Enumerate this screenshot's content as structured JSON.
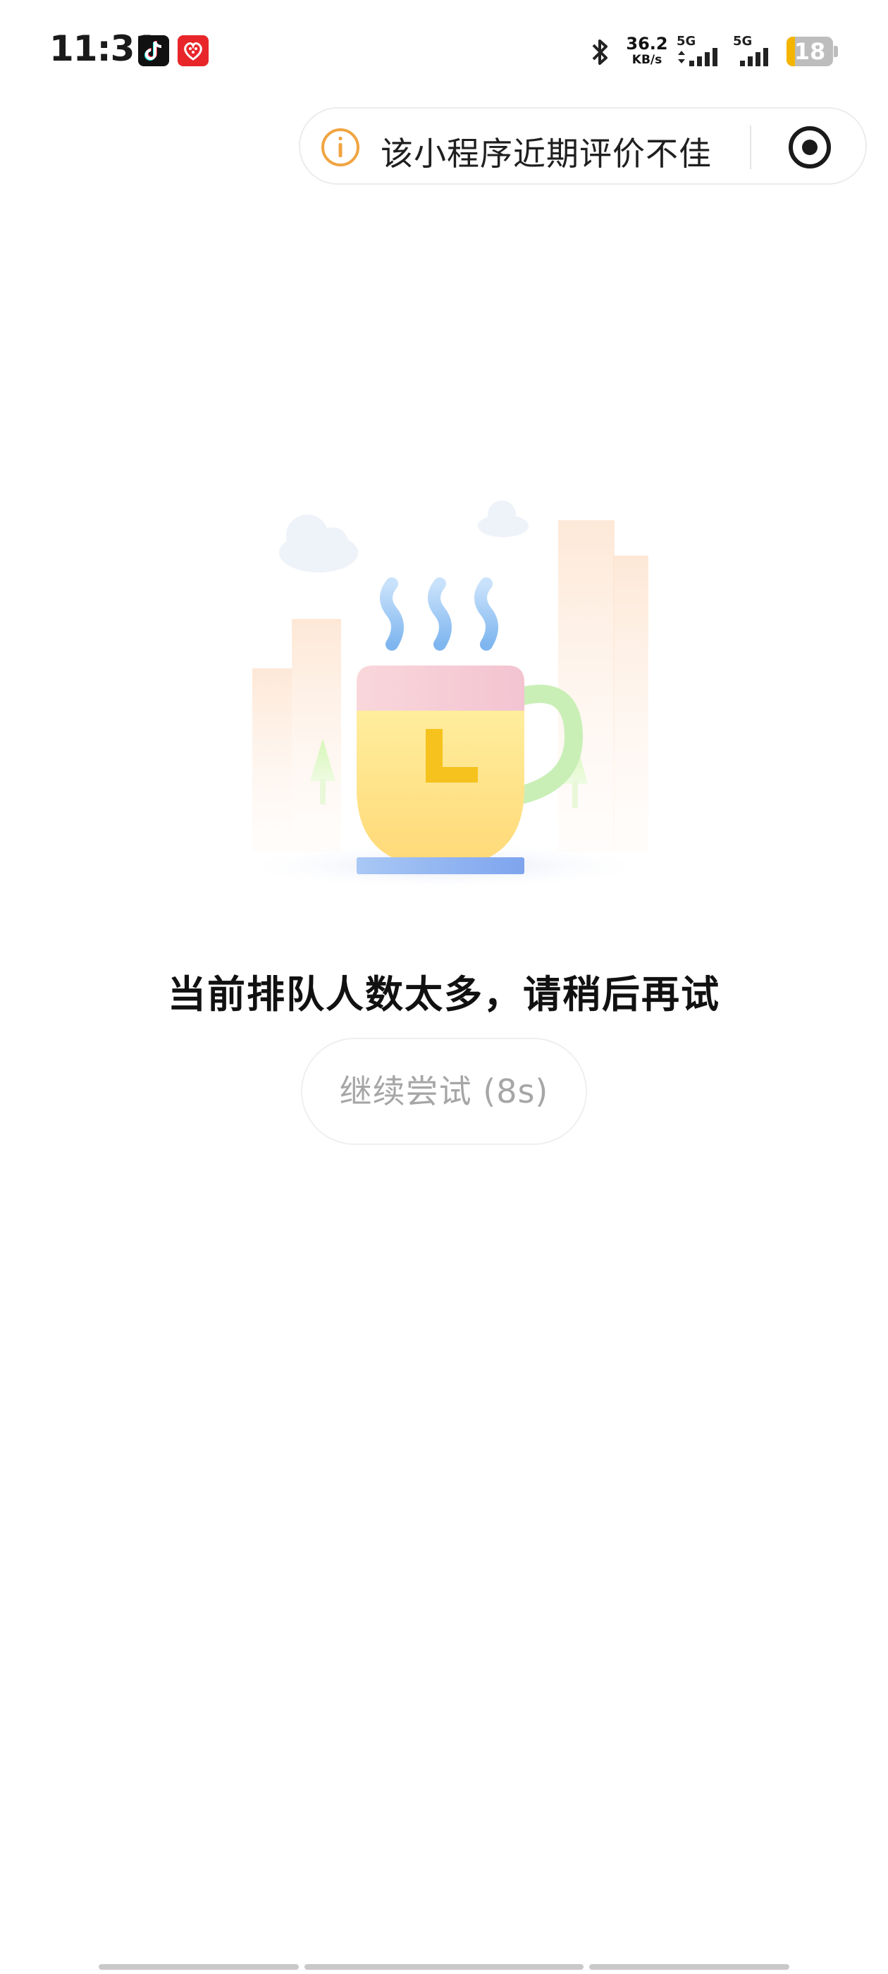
{
  "status_bar": {
    "time": "11:31",
    "apps": [
      "tiktok-icon",
      "red-app-icon"
    ],
    "net_speed_value": "36.2",
    "net_speed_unit": "KB/s",
    "signal1_label": "5G",
    "signal2_label": "5G",
    "battery_level": "18",
    "battery_fraction": 0.18
  },
  "notice": {
    "icon": "info-icon",
    "text": "该小程序近期评价不佳",
    "close_icon": "target-close-icon",
    "accent_color": "#f0a442"
  },
  "main": {
    "illustration": "coffee-cup-illustration",
    "cup_letter": "L",
    "message": "当前排队人数太多，请稍后再试",
    "retry_label": "继续尝试 (8s)"
  }
}
